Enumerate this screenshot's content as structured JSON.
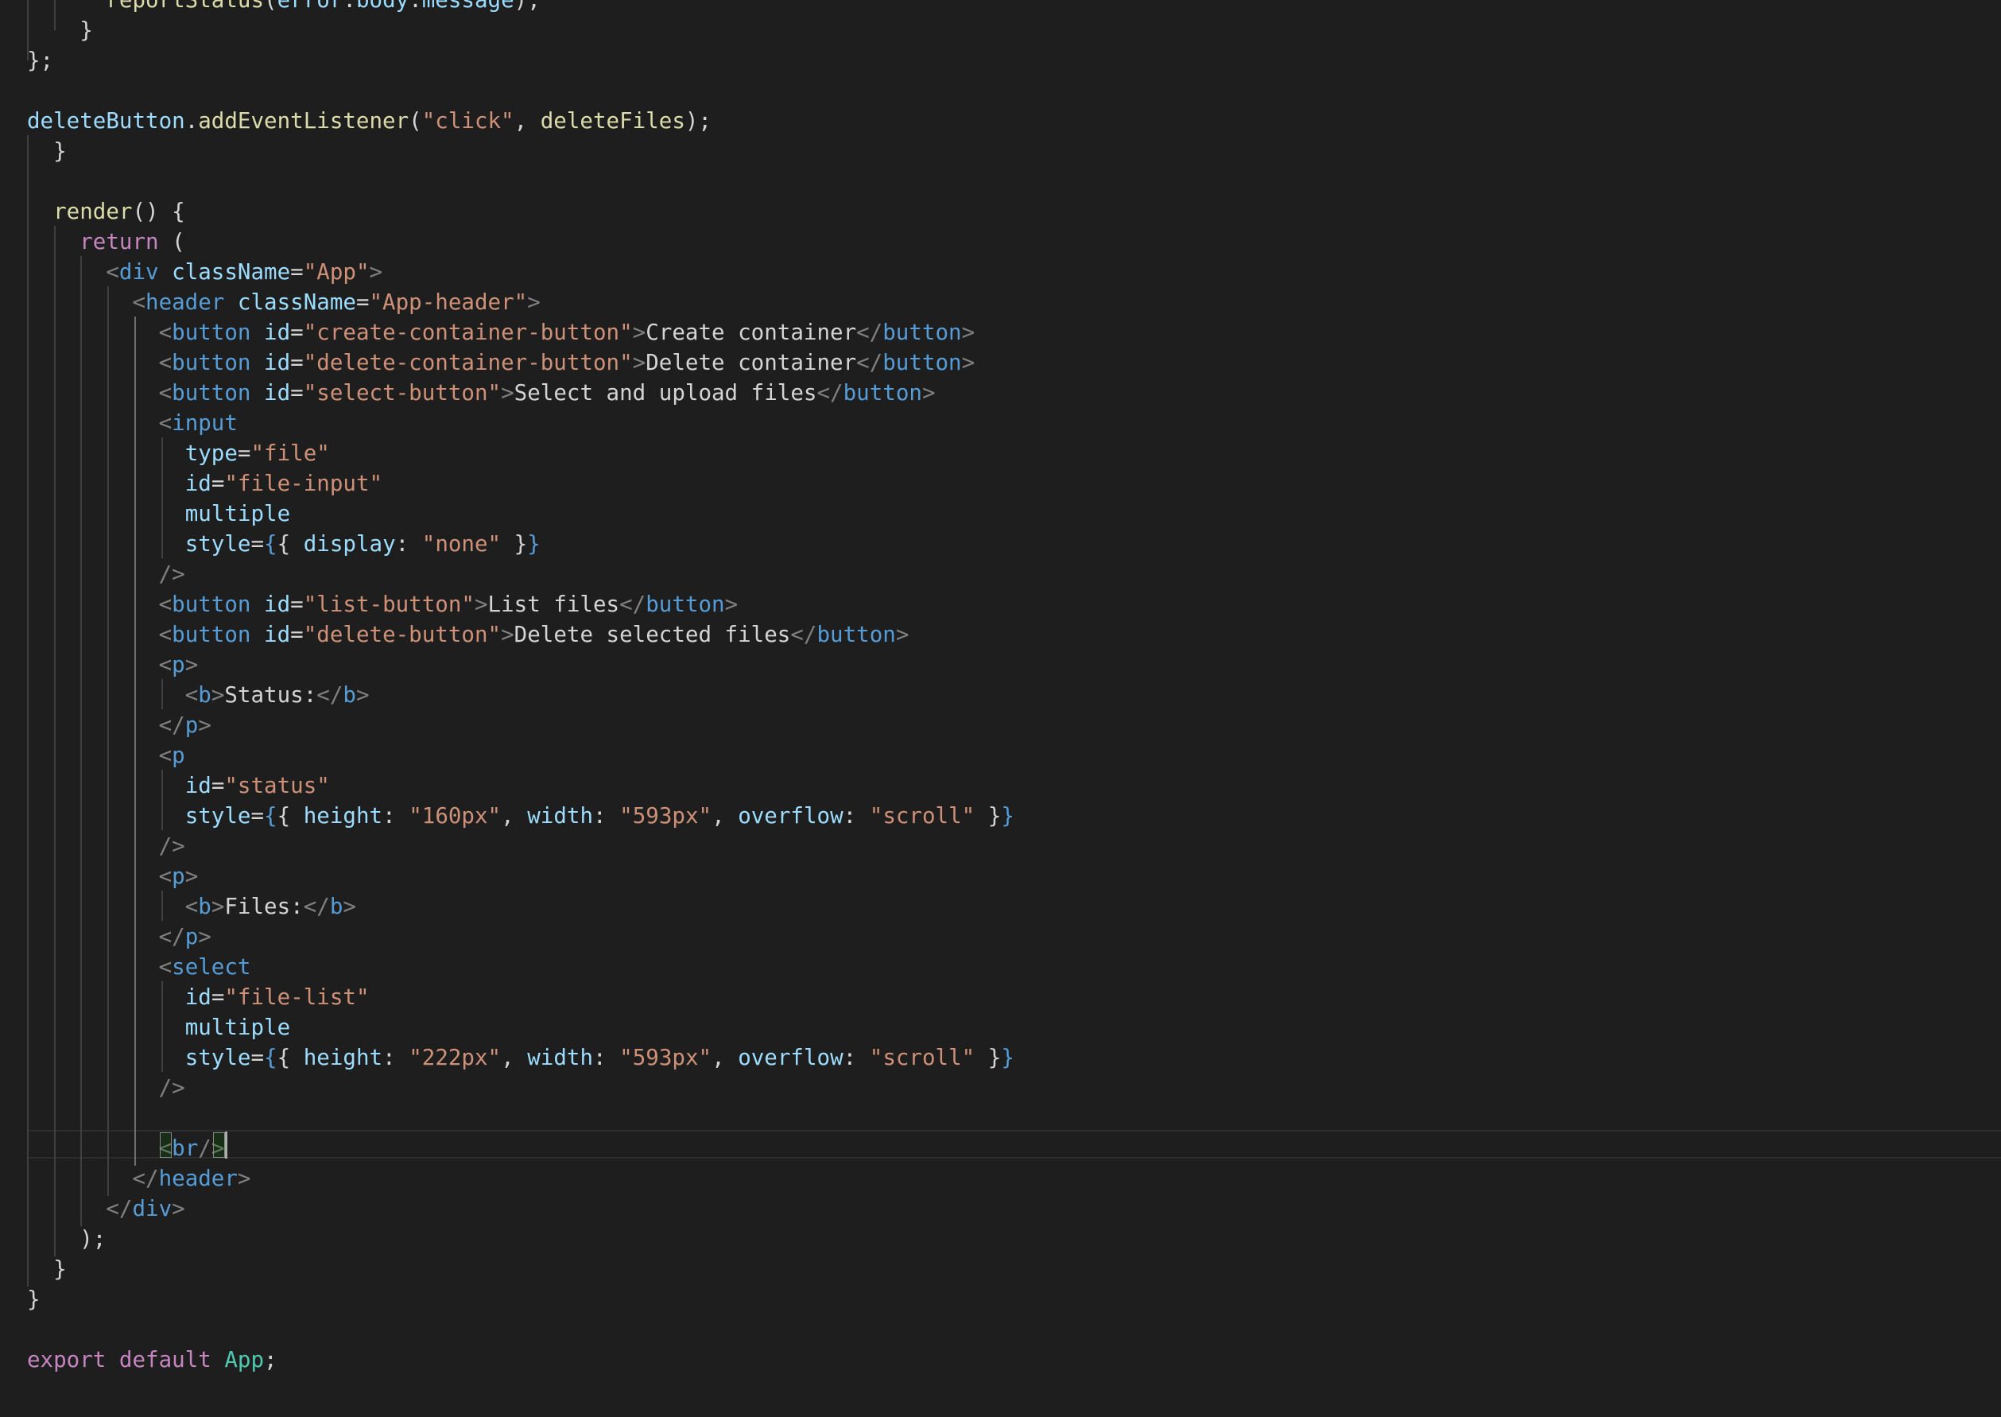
{
  "editor": {
    "language": "javascript-jsx",
    "theme": "dark",
    "cursor_line": 38,
    "lines": [
      [
        {
          "t": "      ",
          "c": "t-text"
        },
        {
          "t": "reportStatus",
          "c": "t-fn"
        },
        {
          "t": "(",
          "c": "t-text"
        },
        {
          "t": "error",
          "c": "t-var"
        },
        {
          "t": ".",
          "c": "t-text"
        },
        {
          "t": "body",
          "c": "t-var"
        },
        {
          "t": ".",
          "c": "t-text"
        },
        {
          "t": "message",
          "c": "t-var"
        },
        {
          "t": ");",
          "c": "t-text"
        }
      ],
      [
        {
          "t": "    }",
          "c": "t-text"
        }
      ],
      [
        {
          "t": "};",
          "c": "t-text"
        }
      ],
      [],
      [
        {
          "t": "deleteButton",
          "c": "t-var"
        },
        {
          "t": ".",
          "c": "t-text"
        },
        {
          "t": "addEventListener",
          "c": "t-fn"
        },
        {
          "t": "(",
          "c": "t-text"
        },
        {
          "t": "\"click\"",
          "c": "t-str"
        },
        {
          "t": ", ",
          "c": "t-text"
        },
        {
          "t": "deleteFiles",
          "c": "t-fn"
        },
        {
          "t": ");",
          "c": "t-text"
        }
      ],
      [
        {
          "t": "  }",
          "c": "t-text"
        }
      ],
      [],
      [
        {
          "t": "  ",
          "c": "t-text"
        },
        {
          "t": "render",
          "c": "t-fn"
        },
        {
          "t": "() {",
          "c": "t-text"
        }
      ],
      [
        {
          "t": "    ",
          "c": "t-text"
        },
        {
          "t": "return",
          "c": "t-kw"
        },
        {
          "t": " (",
          "c": "t-text"
        }
      ],
      [
        {
          "t": "      ",
          "c": "t-text"
        },
        {
          "t": "<",
          "c": "t-punc"
        },
        {
          "t": "div",
          "c": "t-tag"
        },
        {
          "t": " ",
          "c": "t-text"
        },
        {
          "t": "className",
          "c": "t-attr"
        },
        {
          "t": "=",
          "c": "t-text"
        },
        {
          "t": "\"App\"",
          "c": "t-str"
        },
        {
          "t": ">",
          "c": "t-punc"
        }
      ],
      [
        {
          "t": "        ",
          "c": "t-text"
        },
        {
          "t": "<",
          "c": "t-punc"
        },
        {
          "t": "header",
          "c": "t-tag"
        },
        {
          "t": " ",
          "c": "t-text"
        },
        {
          "t": "className",
          "c": "t-attr"
        },
        {
          "t": "=",
          "c": "t-text"
        },
        {
          "t": "\"App-header\"",
          "c": "t-str"
        },
        {
          "t": ">",
          "c": "t-punc"
        }
      ],
      [
        {
          "t": "          ",
          "c": "t-text"
        },
        {
          "t": "<",
          "c": "t-punc"
        },
        {
          "t": "button",
          "c": "t-tag"
        },
        {
          "t": " ",
          "c": "t-text"
        },
        {
          "t": "id",
          "c": "t-attr"
        },
        {
          "t": "=",
          "c": "t-text"
        },
        {
          "t": "\"create-container-button\"",
          "c": "t-str"
        },
        {
          "t": ">",
          "c": "t-punc"
        },
        {
          "t": "Create container",
          "c": "t-text"
        },
        {
          "t": "</",
          "c": "t-punc"
        },
        {
          "t": "button",
          "c": "t-tag"
        },
        {
          "t": ">",
          "c": "t-punc"
        }
      ],
      [
        {
          "t": "          ",
          "c": "t-text"
        },
        {
          "t": "<",
          "c": "t-punc"
        },
        {
          "t": "button",
          "c": "t-tag"
        },
        {
          "t": " ",
          "c": "t-text"
        },
        {
          "t": "id",
          "c": "t-attr"
        },
        {
          "t": "=",
          "c": "t-text"
        },
        {
          "t": "\"delete-container-button\"",
          "c": "t-str"
        },
        {
          "t": ">",
          "c": "t-punc"
        },
        {
          "t": "Delete container",
          "c": "t-text"
        },
        {
          "t": "</",
          "c": "t-punc"
        },
        {
          "t": "button",
          "c": "t-tag"
        },
        {
          "t": ">",
          "c": "t-punc"
        }
      ],
      [
        {
          "t": "          ",
          "c": "t-text"
        },
        {
          "t": "<",
          "c": "t-punc"
        },
        {
          "t": "button",
          "c": "t-tag"
        },
        {
          "t": " ",
          "c": "t-text"
        },
        {
          "t": "id",
          "c": "t-attr"
        },
        {
          "t": "=",
          "c": "t-text"
        },
        {
          "t": "\"select-button\"",
          "c": "t-str"
        },
        {
          "t": ">",
          "c": "t-punc"
        },
        {
          "t": "Select and upload files",
          "c": "t-text"
        },
        {
          "t": "</",
          "c": "t-punc"
        },
        {
          "t": "button",
          "c": "t-tag"
        },
        {
          "t": ">",
          "c": "t-punc"
        }
      ],
      [
        {
          "t": "          ",
          "c": "t-text"
        },
        {
          "t": "<",
          "c": "t-punc"
        },
        {
          "t": "input",
          "c": "t-tag"
        }
      ],
      [
        {
          "t": "            ",
          "c": "t-text"
        },
        {
          "t": "type",
          "c": "t-attr"
        },
        {
          "t": "=",
          "c": "t-text"
        },
        {
          "t": "\"file\"",
          "c": "t-str"
        }
      ],
      [
        {
          "t": "            ",
          "c": "t-text"
        },
        {
          "t": "id",
          "c": "t-attr"
        },
        {
          "t": "=",
          "c": "t-text"
        },
        {
          "t": "\"file-input\"",
          "c": "t-str"
        }
      ],
      [
        {
          "t": "            ",
          "c": "t-text"
        },
        {
          "t": "multiple",
          "c": "t-attr"
        }
      ],
      [
        {
          "t": "            ",
          "c": "t-text"
        },
        {
          "t": "style",
          "c": "t-attr"
        },
        {
          "t": "=",
          "c": "t-text"
        },
        {
          "t": "{",
          "c": "t-brace"
        },
        {
          "t": "{ ",
          "c": "t-text"
        },
        {
          "t": "display",
          "c": "t-attr"
        },
        {
          "t": ": ",
          "c": "t-text"
        },
        {
          "t": "\"none\"",
          "c": "t-str"
        },
        {
          "t": " }",
          "c": "t-text"
        },
        {
          "t": "}",
          "c": "t-brace"
        }
      ],
      [
        {
          "t": "          ",
          "c": "t-text"
        },
        {
          "t": "/>",
          "c": "t-punc"
        }
      ],
      [
        {
          "t": "          ",
          "c": "t-text"
        },
        {
          "t": "<",
          "c": "t-punc"
        },
        {
          "t": "button",
          "c": "t-tag"
        },
        {
          "t": " ",
          "c": "t-text"
        },
        {
          "t": "id",
          "c": "t-attr"
        },
        {
          "t": "=",
          "c": "t-text"
        },
        {
          "t": "\"list-button\"",
          "c": "t-str"
        },
        {
          "t": ">",
          "c": "t-punc"
        },
        {
          "t": "List files",
          "c": "t-text"
        },
        {
          "t": "</",
          "c": "t-punc"
        },
        {
          "t": "button",
          "c": "t-tag"
        },
        {
          "t": ">",
          "c": "t-punc"
        }
      ],
      [
        {
          "t": "          ",
          "c": "t-text"
        },
        {
          "t": "<",
          "c": "t-punc"
        },
        {
          "t": "button",
          "c": "t-tag"
        },
        {
          "t": " ",
          "c": "t-text"
        },
        {
          "t": "id",
          "c": "t-attr"
        },
        {
          "t": "=",
          "c": "t-text"
        },
        {
          "t": "\"delete-button\"",
          "c": "t-str"
        },
        {
          "t": ">",
          "c": "t-punc"
        },
        {
          "t": "Delete selected files",
          "c": "t-text"
        },
        {
          "t": "</",
          "c": "t-punc"
        },
        {
          "t": "button",
          "c": "t-tag"
        },
        {
          "t": ">",
          "c": "t-punc"
        }
      ],
      [
        {
          "t": "          ",
          "c": "t-text"
        },
        {
          "t": "<",
          "c": "t-punc"
        },
        {
          "t": "p",
          "c": "t-tag"
        },
        {
          "t": ">",
          "c": "t-punc"
        }
      ],
      [
        {
          "t": "            ",
          "c": "t-text"
        },
        {
          "t": "<",
          "c": "t-punc"
        },
        {
          "t": "b",
          "c": "t-tag"
        },
        {
          "t": ">",
          "c": "t-punc"
        },
        {
          "t": "Status:",
          "c": "t-text"
        },
        {
          "t": "</",
          "c": "t-punc"
        },
        {
          "t": "b",
          "c": "t-tag"
        },
        {
          "t": ">",
          "c": "t-punc"
        }
      ],
      [
        {
          "t": "          ",
          "c": "t-text"
        },
        {
          "t": "</",
          "c": "t-punc"
        },
        {
          "t": "p",
          "c": "t-tag"
        },
        {
          "t": ">",
          "c": "t-punc"
        }
      ],
      [
        {
          "t": "          ",
          "c": "t-text"
        },
        {
          "t": "<",
          "c": "t-punc"
        },
        {
          "t": "p",
          "c": "t-tag"
        }
      ],
      [
        {
          "t": "            ",
          "c": "t-text"
        },
        {
          "t": "id",
          "c": "t-attr"
        },
        {
          "t": "=",
          "c": "t-text"
        },
        {
          "t": "\"status\"",
          "c": "t-str"
        }
      ],
      [
        {
          "t": "            ",
          "c": "t-text"
        },
        {
          "t": "style",
          "c": "t-attr"
        },
        {
          "t": "=",
          "c": "t-text"
        },
        {
          "t": "{",
          "c": "t-brace"
        },
        {
          "t": "{ ",
          "c": "t-text"
        },
        {
          "t": "height",
          "c": "t-attr"
        },
        {
          "t": ": ",
          "c": "t-text"
        },
        {
          "t": "\"160px\"",
          "c": "t-str"
        },
        {
          "t": ", ",
          "c": "t-text"
        },
        {
          "t": "width",
          "c": "t-attr"
        },
        {
          "t": ": ",
          "c": "t-text"
        },
        {
          "t": "\"593px\"",
          "c": "t-str"
        },
        {
          "t": ", ",
          "c": "t-text"
        },
        {
          "t": "overflow",
          "c": "t-attr"
        },
        {
          "t": ": ",
          "c": "t-text"
        },
        {
          "t": "\"scroll\"",
          "c": "t-str"
        },
        {
          "t": " }",
          "c": "t-text"
        },
        {
          "t": "}",
          "c": "t-brace"
        }
      ],
      [
        {
          "t": "          ",
          "c": "t-text"
        },
        {
          "t": "/>",
          "c": "t-punc"
        }
      ],
      [
        {
          "t": "          ",
          "c": "t-text"
        },
        {
          "t": "<",
          "c": "t-punc"
        },
        {
          "t": "p",
          "c": "t-tag"
        },
        {
          "t": ">",
          "c": "t-punc"
        }
      ],
      [
        {
          "t": "            ",
          "c": "t-text"
        },
        {
          "t": "<",
          "c": "t-punc"
        },
        {
          "t": "b",
          "c": "t-tag"
        },
        {
          "t": ">",
          "c": "t-punc"
        },
        {
          "t": "Files:",
          "c": "t-text"
        },
        {
          "t": "</",
          "c": "t-punc"
        },
        {
          "t": "b",
          "c": "t-tag"
        },
        {
          "t": ">",
          "c": "t-punc"
        }
      ],
      [
        {
          "t": "          ",
          "c": "t-text"
        },
        {
          "t": "</",
          "c": "t-punc"
        },
        {
          "t": "p",
          "c": "t-tag"
        },
        {
          "t": ">",
          "c": "t-punc"
        }
      ],
      [
        {
          "t": "          ",
          "c": "t-text"
        },
        {
          "t": "<",
          "c": "t-punc"
        },
        {
          "t": "select",
          "c": "t-tag"
        }
      ],
      [
        {
          "t": "            ",
          "c": "t-text"
        },
        {
          "t": "id",
          "c": "t-attr"
        },
        {
          "t": "=",
          "c": "t-text"
        },
        {
          "t": "\"file-list\"",
          "c": "t-str"
        }
      ],
      [
        {
          "t": "            ",
          "c": "t-text"
        },
        {
          "t": "multiple",
          "c": "t-attr"
        }
      ],
      [
        {
          "t": "            ",
          "c": "t-text"
        },
        {
          "t": "style",
          "c": "t-attr"
        },
        {
          "t": "=",
          "c": "t-text"
        },
        {
          "t": "{",
          "c": "t-brace"
        },
        {
          "t": "{ ",
          "c": "t-text"
        },
        {
          "t": "height",
          "c": "t-attr"
        },
        {
          "t": ": ",
          "c": "t-text"
        },
        {
          "t": "\"222px\"",
          "c": "t-str"
        },
        {
          "t": ", ",
          "c": "t-text"
        },
        {
          "t": "width",
          "c": "t-attr"
        },
        {
          "t": ": ",
          "c": "t-text"
        },
        {
          "t": "\"593px\"",
          "c": "t-str"
        },
        {
          "t": ", ",
          "c": "t-text"
        },
        {
          "t": "overflow",
          "c": "t-attr"
        },
        {
          "t": ": ",
          "c": "t-text"
        },
        {
          "t": "\"scroll\"",
          "c": "t-str"
        },
        {
          "t": " }",
          "c": "t-text"
        },
        {
          "t": "}",
          "c": "t-brace"
        }
      ],
      [
        {
          "t": "          ",
          "c": "t-text"
        },
        {
          "t": "/>",
          "c": "t-punc"
        }
      ],
      [],
      [
        {
          "t": "          ",
          "c": "t-text"
        },
        {
          "t": "<",
          "c": "t-punc"
        },
        {
          "t": "br",
          "c": "t-tag"
        },
        {
          "t": "/>",
          "c": "t-punc"
        }
      ],
      [
        {
          "t": "        ",
          "c": "t-text"
        },
        {
          "t": "</",
          "c": "t-punc"
        },
        {
          "t": "header",
          "c": "t-tag"
        },
        {
          "t": ">",
          "c": "t-punc"
        }
      ],
      [
        {
          "t": "      ",
          "c": "t-text"
        },
        {
          "t": "</",
          "c": "t-punc"
        },
        {
          "t": "div",
          "c": "t-tag"
        },
        {
          "t": ">",
          "c": "t-punc"
        }
      ],
      [
        {
          "t": "    );",
          "c": "t-text"
        }
      ],
      [
        {
          "t": "  }",
          "c": "t-text"
        }
      ],
      [
        {
          "t": "}",
          "c": "t-text"
        }
      ],
      [],
      [
        {
          "t": "export",
          "c": "t-kw"
        },
        {
          "t": " ",
          "c": "t-text"
        },
        {
          "t": "default",
          "c": "t-kw"
        },
        {
          "t": " ",
          "c": "t-text"
        },
        {
          "t": "App",
          "c": "t-cls"
        },
        {
          "t": ";",
          "c": "t-text"
        }
      ]
    ]
  }
}
